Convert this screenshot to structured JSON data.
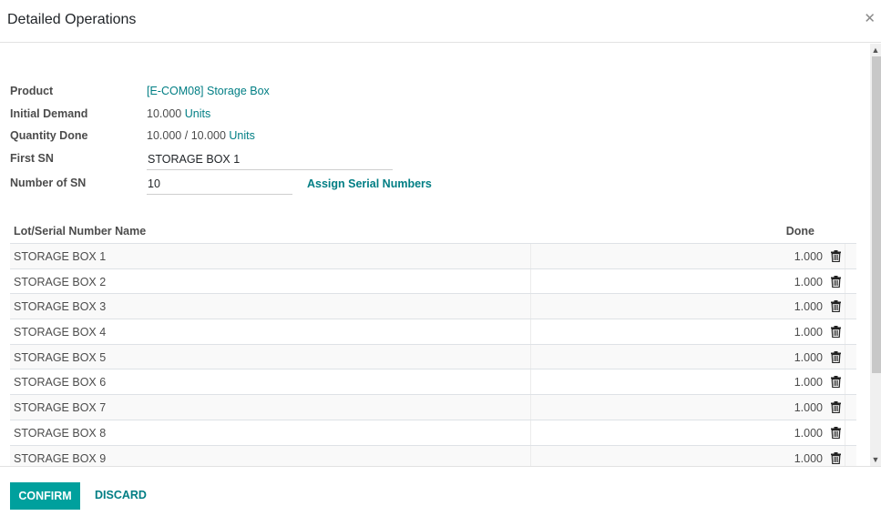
{
  "dialog": {
    "title": "Detailed Operations",
    "close_icon": "close-icon"
  },
  "form": {
    "product_label": "Product",
    "product_value": "[E-COM08] Storage Box",
    "initial_demand_label": "Initial Demand",
    "initial_demand_qty": "10.000",
    "initial_demand_uom": "Units",
    "quantity_done_label": "Quantity Done",
    "quantity_done_value": "10.000",
    "quantity_done_sep": "/",
    "quantity_done_total": "10.000",
    "quantity_done_uom": "Units",
    "first_sn_label": "First SN",
    "first_sn_value": "STORAGE BOX 1",
    "number_of_sn_label": "Number of SN",
    "number_of_sn_value": "10",
    "assign_button": "Assign Serial Numbers"
  },
  "table": {
    "headers": {
      "name": "Lot/Serial Number Name",
      "done": "Done"
    },
    "rows": [
      {
        "name": "STORAGE BOX 1",
        "done": "1.000"
      },
      {
        "name": "STORAGE BOX 2",
        "done": "1.000"
      },
      {
        "name": "STORAGE BOX 3",
        "done": "1.000"
      },
      {
        "name": "STORAGE BOX 4",
        "done": "1.000"
      },
      {
        "name": "STORAGE BOX 5",
        "done": "1.000"
      },
      {
        "name": "STORAGE BOX 6",
        "done": "1.000"
      },
      {
        "name": "STORAGE BOX 7",
        "done": "1.000"
      },
      {
        "name": "STORAGE BOX 8",
        "done": "1.000"
      },
      {
        "name": "STORAGE BOX 9",
        "done": "1.000"
      }
    ],
    "row_icon": "trash-icon"
  },
  "footer": {
    "confirm_label": "CONFIRM",
    "discard_label": "DISCARD"
  },
  "colors": {
    "primary": "#00a09d",
    "link": "#017e84"
  }
}
